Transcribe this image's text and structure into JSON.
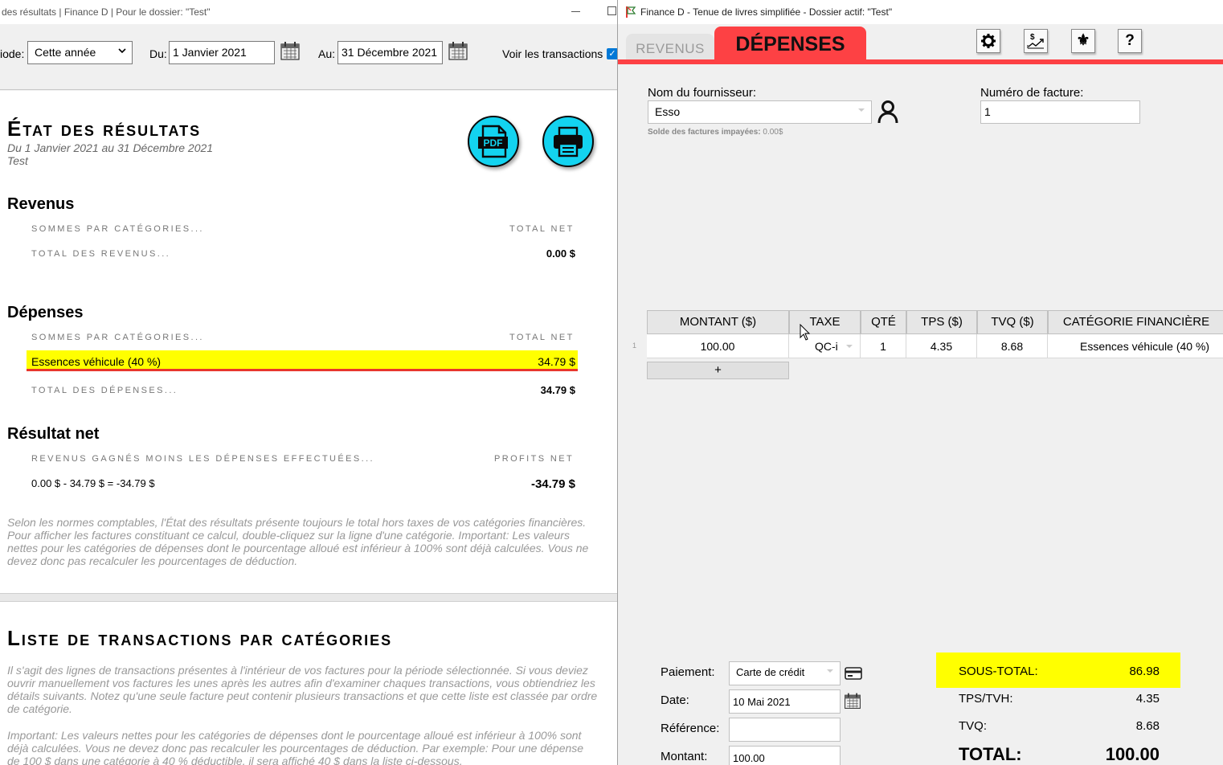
{
  "left_window": {
    "title": "des résultats | Finance D | Pour le dossier: \"Test\"",
    "toolbar": {
      "period_label": "iode:",
      "period_value": "Cette année",
      "from_label": "Du:",
      "from_value": "1 Janvier 2021",
      "to_label": "Au:",
      "to_value": "31 Décembre 2021",
      "show_transactions_label": "Voir les transactions"
    },
    "report": {
      "title": "État des résultats",
      "subtitle_dates": "Du 1 Janvier 2021 au 31 Décembre 2021",
      "subtitle_folder": "Test",
      "pdf_icon_text": "PDF",
      "revenus": {
        "heading": "Revenus",
        "col_left": "Sommes par catégories...",
        "col_right": "Total net",
        "total_label": "Total des revenus...",
        "total_value": "0.00 $"
      },
      "depenses": {
        "heading": "Dépenses",
        "col_left": "Sommes par catégories...",
        "col_right": "Total net",
        "row_label": "Essences véhicule (40 %)",
        "row_value": "34.79 $",
        "total_label": "Total des dépenses...",
        "total_value": "34.79 $"
      },
      "net": {
        "heading": "Résultat net",
        "col_left": "Revenus gagnés moins les dépenses effectuées...",
        "col_right": "Profits net",
        "formula": "0.00 $ - 34.79 $ = -34.79 $",
        "value": "-34.79 $"
      },
      "note": "Selon les normes comptables, l'État des résultats présente toujours le total hors taxes de vos catégories financières. Pour afficher les factures constituant ce calcul, double-cliquez sur la ligne d'une catégorie. Important: Les valeurs nettes pour les catégories de dépenses dont le pourcentage alloué est inférieur à 100% sont déjà calculées. Vous ne devez donc pas recalculer les pourcentages de déduction."
    },
    "list": {
      "title": "Liste de transactions par catégories",
      "para1": "Il s'agit des lignes de transactions présentes à l'intérieur de vos factures pour la période sélectionnée. Si vous deviez ouvrir manuellement vos factures les unes après les autres afin d'examiner chaques transactions, vous obtiendriez les détails suivants. Notez qu'une seule facture peut contenir plusieurs transactions et que cette liste est classée par ordre de catégorie.",
      "para2": "Important: Les valeurs nettes pour les catégories de dépenses dont le pourcentage alloué est inférieur à 100% sont déjà calculées. Vous ne devez donc pas recalculer les pourcentages de déduction. Par exemple: Pour une dépense de 100 $ dans une catégorie à 40 % déductible, il sera affiché 40 $ dans la liste ci-dessous."
    }
  },
  "right_window": {
    "title": "Finance D - Tenue de livres simplifiée - Dossier actif: \"Test\"",
    "tabs": {
      "inactive": "REVENUS",
      "active": "DÉPENSES"
    },
    "toolbar_icons": [
      "gear-icon",
      "money-chart-icon",
      "fleur-de-lis-icon",
      "help-icon"
    ],
    "help_glyph": "?",
    "fleur_glyph": "⚜",
    "supplier": {
      "label": "Nom du fournisseur:",
      "value": "Esso",
      "unpaid_label": "Solde des factures impayées:",
      "unpaid_value": "0.00$"
    },
    "invoice": {
      "label": "Numéro de facture:",
      "value": "1"
    },
    "grid": {
      "headers": [
        "MONTANT ($)",
        "TAXE",
        "QTÉ",
        "TPS ($)",
        "TVQ ($)",
        "CATÉGORIE FINANCIÈRE"
      ],
      "row_number": "1",
      "row": [
        "100.00",
        "QC-i",
        "1",
        "4.35",
        "8.68",
        "Essences véhicule (40 %)"
      ],
      "add_label": "+"
    },
    "form": {
      "payment_label": "Paiement:",
      "payment_value": "Carte de crédit",
      "date_label": "Date:",
      "date_value": "10 Mai 2021",
      "reference_label": "Référence:",
      "reference_value": "",
      "amount_label": "Montant:",
      "amount_value": "100.00"
    },
    "summary": {
      "subtotal_label": "SOUS-TOTAL:",
      "subtotal_value": "86.98",
      "tps_label": "TPS/TVH:",
      "tps_value": "4.35",
      "tvq_label": "TVQ:",
      "tvq_value": "8.68",
      "total_label": "TOTAL:",
      "total_value": "100.00"
    },
    "colors": {
      "accent_red": "#fd4144",
      "highlight_yellow": "#ffff00",
      "button_cyan": "#13d3f0"
    }
  }
}
